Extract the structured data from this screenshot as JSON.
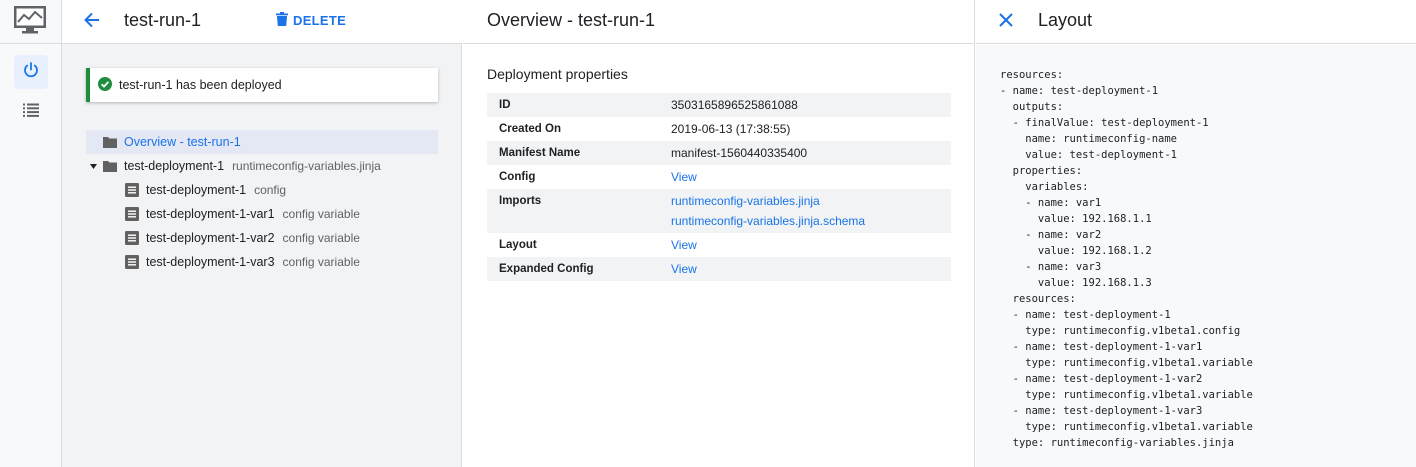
{
  "colors": {
    "accent": "#1a73e8",
    "success": "#1e8e3e",
    "rail_bg": "#f8f9fa",
    "tree_bg": "#f1f3f4"
  },
  "rail": {
    "logo_icon": "monitor-chart-icon",
    "items": [
      {
        "icon": "power-icon",
        "active": true
      },
      {
        "icon": "list-icon",
        "active": false
      }
    ]
  },
  "tree_panel": {
    "title": "test-run-1",
    "delete_label": "DELETE",
    "toast": "test-run-1 has been deployed",
    "items": [
      {
        "label": "Overview - test-run-1",
        "sub": "",
        "icon": "folder-icon",
        "selected": true
      },
      {
        "label": "test-deployment-1",
        "sub": "runtimeconfig-variables.jinja",
        "icon": "folder-icon",
        "expanded": true
      },
      {
        "label": "test-deployment-1",
        "sub": "config",
        "icon": "document-icon"
      },
      {
        "label": "test-deployment-1-var1",
        "sub": "config variable",
        "icon": "document-icon"
      },
      {
        "label": "test-deployment-1-var2",
        "sub": "config variable",
        "icon": "document-icon"
      },
      {
        "label": "test-deployment-1-var3",
        "sub": "config variable",
        "icon": "document-icon"
      }
    ]
  },
  "overview": {
    "title": "Overview - test-run-1",
    "section": "Deployment properties",
    "rows": [
      {
        "key": "ID",
        "value": "3503165896525861088"
      },
      {
        "key": "Created On",
        "value": "2019-06-13 (17:38:55)"
      },
      {
        "key": "Manifest Name",
        "value": "manifest-1560440335400"
      },
      {
        "key": "Config",
        "link": "View"
      },
      {
        "key": "Imports",
        "link": "runtimeconfig-variables.jinja",
        "link2": "runtimeconfig-variables.jinja.schema"
      },
      {
        "key": "Layout",
        "link": "View"
      },
      {
        "key": "Expanded Config",
        "link": "View"
      }
    ]
  },
  "layout_panel": {
    "title": "Layout",
    "code": "resources:\n- name: test-deployment-1\n  outputs:\n  - finalValue: test-deployment-1\n    name: runtimeconfig-name\n    value: test-deployment-1\n  properties:\n    variables:\n    - name: var1\n      value: 192.168.1.1\n    - name: var2\n      value: 192.168.1.2\n    - name: var3\n      value: 192.168.1.3\n  resources:\n  - name: test-deployment-1\n    type: runtimeconfig.v1beta1.config\n  - name: test-deployment-1-var1\n    type: runtimeconfig.v1beta1.variable\n  - name: test-deployment-1-var2\n    type: runtimeconfig.v1beta1.variable\n  - name: test-deployment-1-var3\n    type: runtimeconfig.v1beta1.variable\n  type: runtimeconfig-variables.jinja"
  }
}
